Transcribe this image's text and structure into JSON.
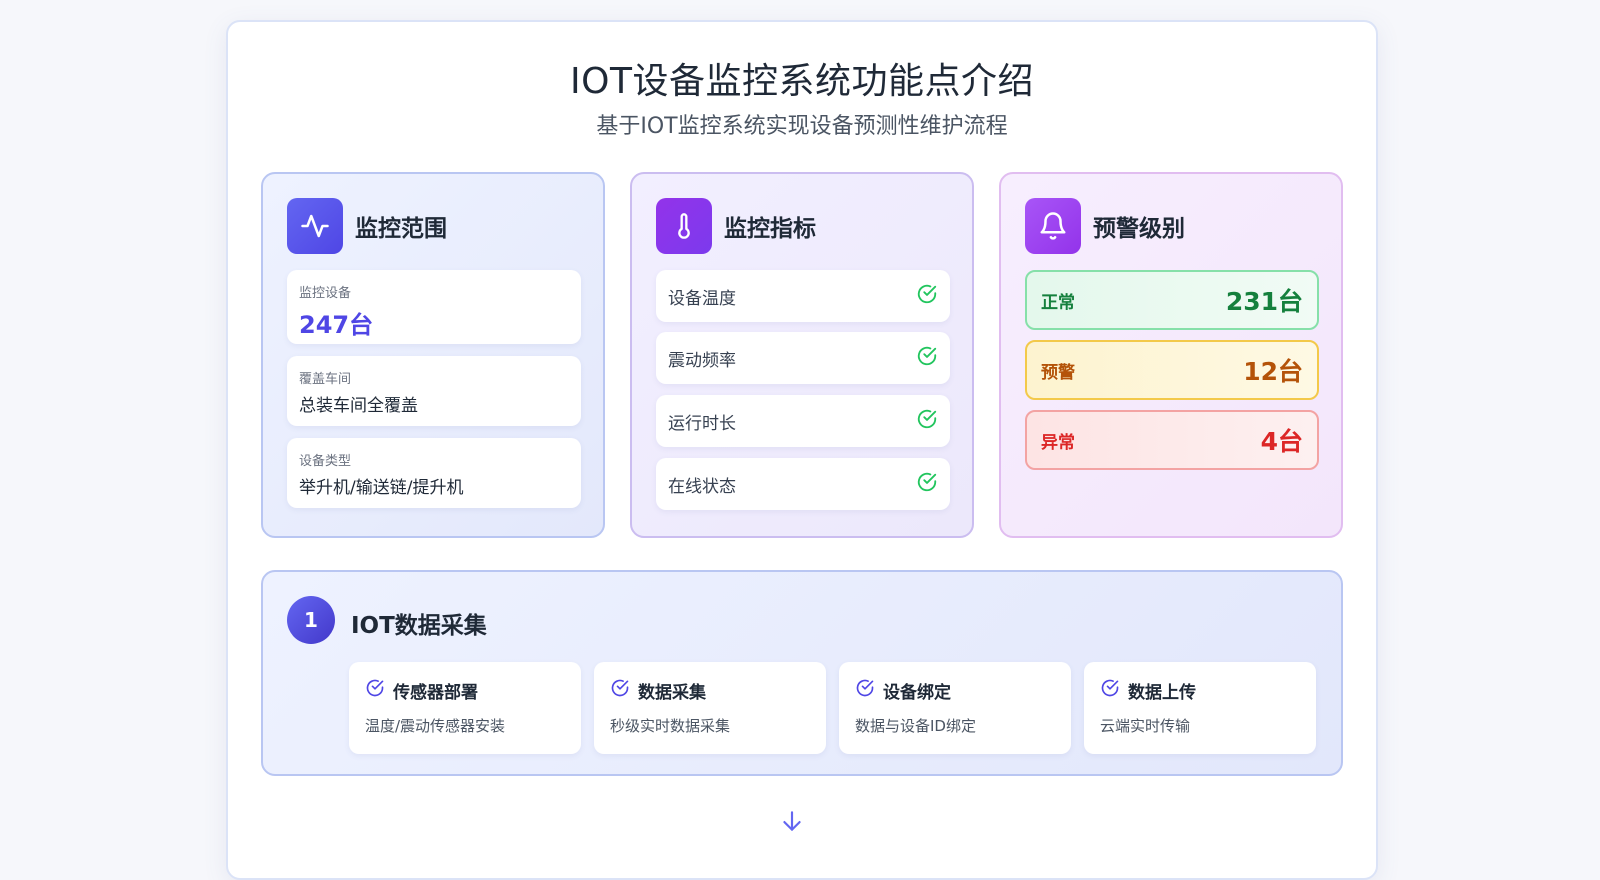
{
  "header": {
    "title": "IOT设备监控系统功能点介绍",
    "subtitle": "基于IOT监控系统实现设备预测性维护流程"
  },
  "scope_card": {
    "title": "监控范围",
    "icon": "activity-icon",
    "items": [
      {
        "label": "监控设备",
        "value": "247台"
      },
      {
        "label": "覆盖车间",
        "value": "总装车间全覆盖"
      },
      {
        "label": "设备类型",
        "value": "举升机/输送链/提升机"
      }
    ]
  },
  "metrics_card": {
    "title": "监控指标",
    "icon": "thermometer-icon",
    "items": [
      {
        "label": "设备温度"
      },
      {
        "label": "震动频率"
      },
      {
        "label": "运行时长"
      },
      {
        "label": "在线状态"
      }
    ]
  },
  "alert_card": {
    "title": "预警级别",
    "icon": "bell-icon",
    "levels": [
      {
        "name": "正常",
        "value": "231台",
        "color": "#15803d"
      },
      {
        "name": "预警",
        "value": "12台",
        "color": "#b45309"
      },
      {
        "name": "异常",
        "value": "4台",
        "color": "#dc2626"
      }
    ]
  },
  "stage": {
    "number": "1",
    "title": "IOT数据采集",
    "steps": [
      {
        "title": "传感器部署",
        "desc": "温度/震动传感器安装"
      },
      {
        "title": "数据采集",
        "desc": "秒级实时数据采集"
      },
      {
        "title": "设备绑定",
        "desc": "数据与设备ID绑定"
      },
      {
        "title": "数据上传",
        "desc": "云端实时传输"
      }
    ]
  },
  "colors": {
    "accent": "#4f46e5",
    "check": "#22c55e"
  }
}
